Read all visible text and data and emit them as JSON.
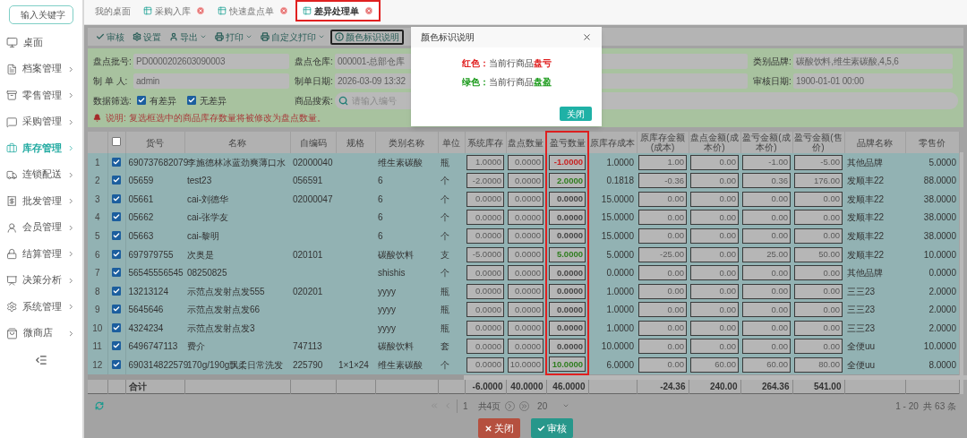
{
  "sidebar": {
    "search": {
      "placeholder": "输入关键字"
    },
    "items": [
      {
        "label": "桌面",
        "selected": false,
        "arrow": false
      },
      {
        "label": "档案管理",
        "selected": false,
        "arrow": true
      },
      {
        "label": "零售管理",
        "selected": false,
        "arrow": true
      },
      {
        "label": "采购管理",
        "selected": false,
        "arrow": true
      },
      {
        "label": "库存管理",
        "selected": true,
        "arrow": true
      },
      {
        "label": "连锁配送",
        "selected": false,
        "arrow": true
      },
      {
        "label": "批发管理",
        "selected": false,
        "arrow": true
      },
      {
        "label": "会员管理",
        "selected": false,
        "arrow": true
      },
      {
        "label": "结算管理",
        "selected": false,
        "arrow": true
      },
      {
        "label": "决策分析",
        "selected": false,
        "arrow": true
      },
      {
        "label": "系统管理",
        "selected": false,
        "arrow": true
      },
      {
        "label": "微商店",
        "selected": false,
        "arrow": true
      }
    ]
  },
  "tabs": [
    {
      "label": "我的桌面",
      "closable": false,
      "selected": false
    },
    {
      "label": "采购入库",
      "closable": true,
      "selected": false
    },
    {
      "label": "快速盘点单",
      "closable": true,
      "selected": false
    },
    {
      "label": "差异处理单",
      "closable": true,
      "selected": true
    }
  ],
  "toolbar": [
    {
      "label": "审核",
      "dropdown": false,
      "highlighted": false
    },
    {
      "label": "设置",
      "dropdown": false,
      "highlighted": false
    },
    {
      "label": "导出",
      "dropdown": true,
      "highlighted": false
    },
    {
      "label": "打印",
      "dropdown": true,
      "highlighted": false
    },
    {
      "label": "自定义打印",
      "dropdown": true,
      "highlighted": false
    },
    {
      "label": "颜色标识说明",
      "dropdown": false,
      "highlighted": true
    }
  ],
  "form": {
    "rows": [
      [
        {
          "label": "盘点批号:",
          "value": "PD0000202603090003"
        },
        {
          "label": "盘点仓库:",
          "value": "000001-总部仓库"
        },
        {
          "label": "类别品牌:",
          "value": "碳酸饮料,维生素碳酸,4,5,6"
        }
      ],
      [
        {
          "label": "制 单 人:",
          "value": "admin"
        },
        {
          "label": "制单日期:",
          "value": "2026-03-09 13:32"
        },
        {
          "label": "审核日期:",
          "value": "1900-01-01 00:00"
        }
      ]
    ],
    "filter": {
      "label": "数据筛选:",
      "options": [
        {
          "label": "有差异",
          "checked": true
        },
        {
          "label": "无差异",
          "checked": true
        }
      ]
    },
    "search": {
      "label": "商品搜索:",
      "placeholder": "请输入编号"
    },
    "note": "说明: 复选框选中的商品库存数量将被修改为盘点数量。"
  },
  "table": {
    "header_checked": false,
    "total_label": "合计",
    "columns": [
      {
        "label": "货号",
        "kind": "text",
        "highlighted": false
      },
      {
        "label": "名称",
        "kind": "text",
        "highlighted": false
      },
      {
        "label": "自编码",
        "kind": "text",
        "highlighted": false
      },
      {
        "label": "规格",
        "kind": "text",
        "highlighted": false
      },
      {
        "label": "类别名称",
        "kind": "text",
        "highlighted": false
      },
      {
        "label": "单位",
        "kind": "text",
        "highlighted": false
      },
      {
        "label": "系统库存",
        "kind": "input",
        "highlighted": false,
        "total": "-6.0000"
      },
      {
        "label": "盘点数量",
        "kind": "input",
        "highlighted": false,
        "total": "40.0000"
      },
      {
        "label": "盈亏数量",
        "kind": "diff",
        "highlighted": true,
        "total": "46.0000"
      },
      {
        "label": "原库存成本",
        "kind": "num",
        "highlighted": false
      },
      {
        "label": "原库存金额(成本)",
        "kind": "input",
        "highlighted": false,
        "total": "-24.36"
      },
      {
        "label": "盘点金额(成本价)",
        "kind": "input",
        "highlighted": false,
        "total": "240.00"
      },
      {
        "label": "盈亏金额(成本价)",
        "kind": "input",
        "highlighted": false,
        "total": "264.36"
      },
      {
        "label": "盈亏金额(售价)",
        "kind": "input",
        "highlighted": false,
        "total": "541.00"
      },
      {
        "label": "品牌名称",
        "kind": "text",
        "highlighted": false
      },
      {
        "label": "零售价",
        "kind": "num",
        "highlighted": false
      }
    ],
    "rows": [
      {
        "no": "1",
        "checked": true,
        "color": "#c81e1e",
        "cells": [
          "690737682079",
          "李施德林冰蓝劲爽薄口水",
          "02000040",
          "",
          "维生素碳酸",
          "瓶",
          "1.0000",
          "0.0000",
          "-1.0000",
          "1.0000",
          "1.00",
          "0.00",
          "-1.00",
          "-5.00",
          "其他品牌",
          "5.0000"
        ]
      },
      {
        "no": "2",
        "checked": true,
        "color": "#2e7d1e",
        "cells": [
          "05659",
          "test23",
          "056591",
          "",
          "6",
          "个",
          "-2.0000",
          "0.0000",
          "2.0000",
          "0.1818",
          "-0.36",
          "0.00",
          "0.36",
          "176.00",
          "发顺丰22",
          "88.0000"
        ]
      },
      {
        "no": "3",
        "checked": true,
        "color": "#444444",
        "cells": [
          "05661",
          "cai-刘德华",
          "02000047",
          "",
          "6",
          "个",
          "0.0000",
          "0.0000",
          "0.0000",
          "15.0000",
          "0.00",
          "0.00",
          "0.00",
          "0.00",
          "发顺丰22",
          "38.0000"
        ]
      },
      {
        "no": "4",
        "checked": true,
        "color": "#444444",
        "cells": [
          "05662",
          "cai-张学友",
          "",
          "",
          "6",
          "个",
          "0.0000",
          "0.0000",
          "0.0000",
          "15.0000",
          "0.00",
          "0.00",
          "0.00",
          "0.00",
          "发顺丰22",
          "38.0000"
        ]
      },
      {
        "no": "5",
        "checked": true,
        "color": "#444444",
        "cells": [
          "05663",
          "cai-黎明",
          "",
          "",
          "6",
          "个",
          "0.0000",
          "0.0000",
          "0.0000",
          "15.0000",
          "0.00",
          "0.00",
          "0.00",
          "0.00",
          "发顺丰22",
          "38.0000"
        ]
      },
      {
        "no": "6",
        "checked": true,
        "color": "#2e7d1e",
        "cells": [
          "697979755",
          "次奥是",
          "020101",
          "",
          "碳酸饮料",
          "支",
          "-5.0000",
          "0.0000",
          "5.0000",
          "5.0000",
          "-25.00",
          "0.00",
          "25.00",
          "50.00",
          "发顺丰22",
          "10.0000"
        ]
      },
      {
        "no": "7",
        "checked": true,
        "color": "#444444",
        "cells": [
          "56545556545",
          "08250825",
          "",
          "",
          "shishis",
          "个",
          "0.0000",
          "0.0000",
          "0.0000",
          "0.0000",
          "0.00",
          "0.00",
          "0.00",
          "0.00",
          "其他品牌",
          "0.0000"
        ]
      },
      {
        "no": "8",
        "checked": true,
        "color": "#444444",
        "cells": [
          "13213124",
          "示范点发射点发555",
          "020201",
          "",
          "yyyy",
          "瓶",
          "0.0000",
          "0.0000",
          "0.0000",
          "1.0000",
          "0.00",
          "0.00",
          "0.00",
          "0.00",
          "三三23",
          "2.0000"
        ]
      },
      {
        "no": "9",
        "checked": true,
        "color": "#444444",
        "cells": [
          "5645646",
          "示范点发射点发66",
          "",
          "",
          "yyyy",
          "瓶",
          "0.0000",
          "0.0000",
          "0.0000",
          "1.0000",
          "0.00",
          "0.00",
          "0.00",
          "0.00",
          "三三23",
          "2.0000"
        ]
      },
      {
        "no": "10",
        "checked": true,
        "color": "#444444",
        "cells": [
          "4324234",
          "示范点发射点发3",
          "",
          "",
          "yyyy",
          "瓶",
          "0.0000",
          "0.0000",
          "0.0000",
          "1.0000",
          "0.00",
          "0.00",
          "0.00",
          "0.00",
          "三三23",
          "2.0000"
        ]
      },
      {
        "no": "11",
        "checked": true,
        "color": "#444444",
        "cells": [
          "6496747113",
          "费介",
          "747113",
          "",
          "碳酸饮料",
          "套",
          "0.0000",
          "0.0000",
          "0.0000",
          "10.0000",
          "0.00",
          "0.00",
          "0.00",
          "0.00",
          "全便uu",
          "10.0000"
        ]
      },
      {
        "no": "12",
        "checked": true,
        "color": "#2e7d1e",
        "cells": [
          "690314822579",
          "170g/190g飘柔日常洗发",
          "225790",
          "1×1×24",
          "维生素碳酸",
          "个",
          "0.0000",
          "10.0000",
          "10.0000",
          "6.0000",
          "0.00",
          "60.00",
          "60.00",
          "80.00",
          "全便uu",
          "8.0000"
        ]
      }
    ]
  },
  "pager": {
    "page": "1",
    "pages": "共4页",
    "size": "20",
    "summary": "1 - 20  共 63 条"
  },
  "actions": [
    {
      "label": "关闭",
      "kind": "close"
    },
    {
      "label": "审核",
      "kind": "approve"
    }
  ],
  "modal": {
    "title": "颜色标识说明",
    "lines": [
      {
        "label": "红色：",
        "text": "当前行商品",
        "term": "盘亏",
        "color": "#e02020"
      },
      {
        "label": "绿色：",
        "text": "当前行商品",
        "term": "盘盈",
        "color": "#1a9a1a"
      }
    ],
    "button": "关闭"
  }
}
